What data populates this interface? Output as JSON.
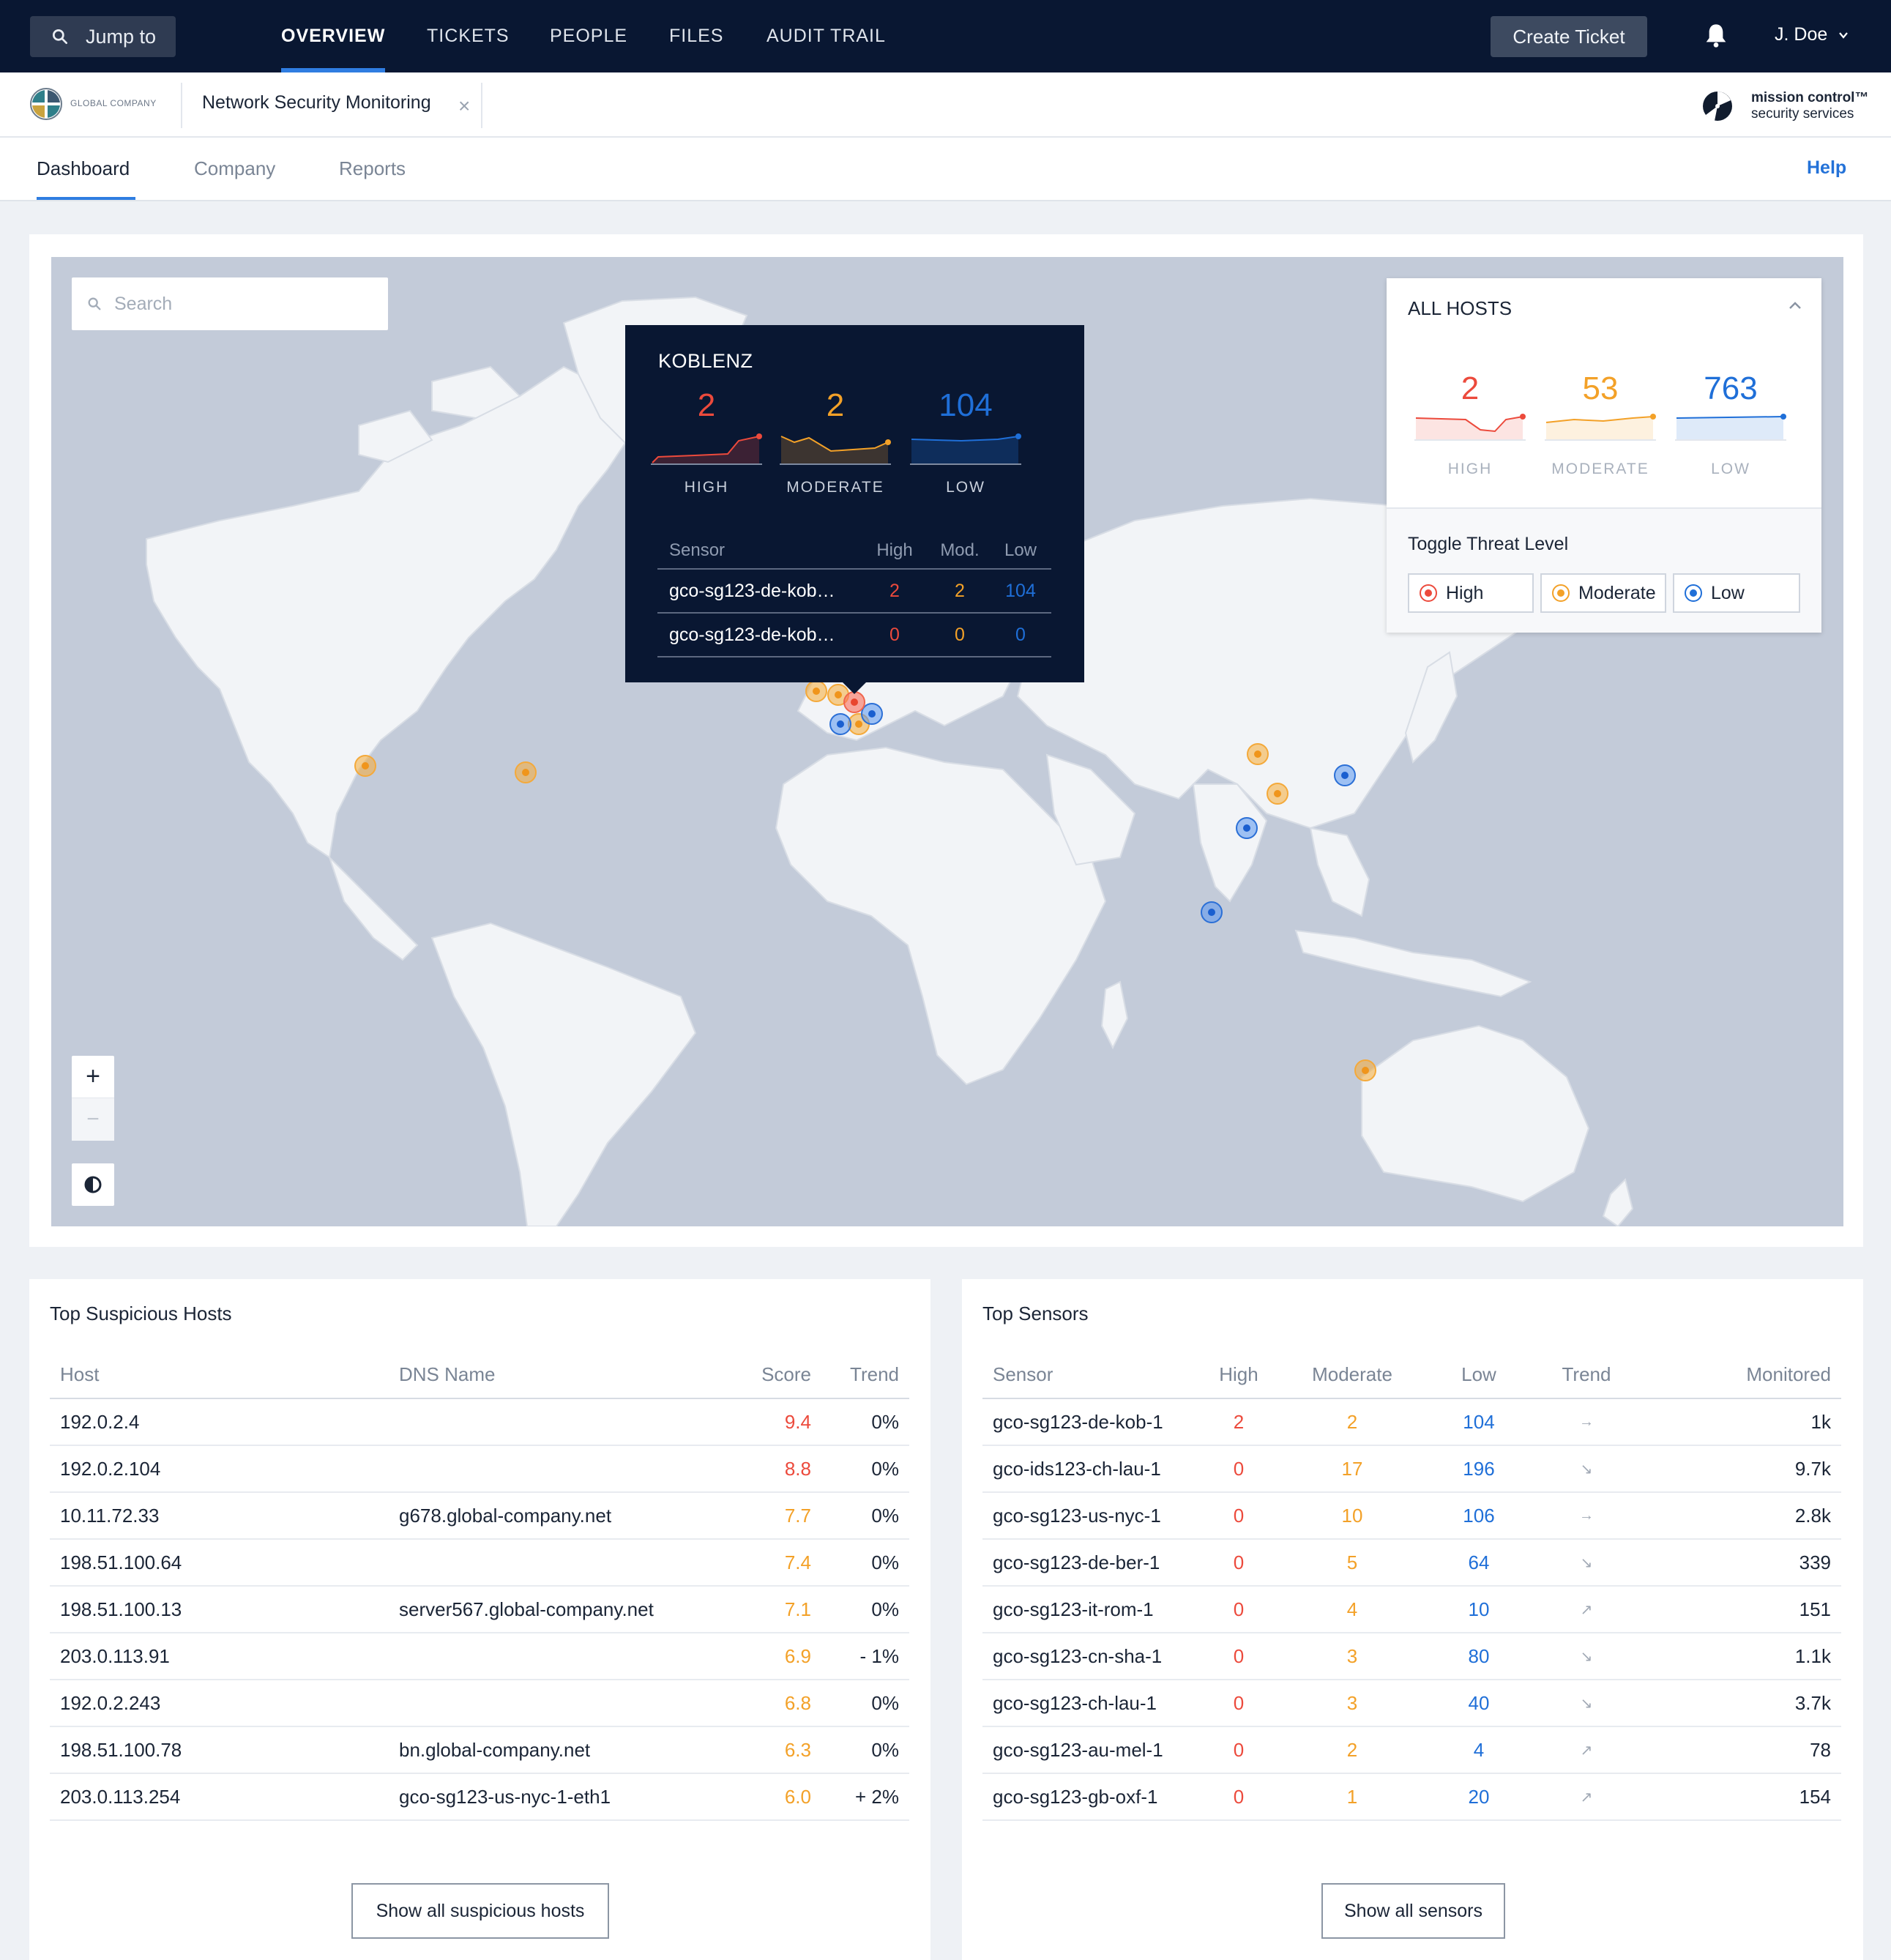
{
  "topnav": {
    "jump_label": "Jump to",
    "items": [
      "OVERVIEW",
      "TICKETS",
      "PEOPLE",
      "FILES",
      "AUDIT TRAIL"
    ],
    "create_label": "Create Ticket",
    "user_name": "J. Doe"
  },
  "header": {
    "company_logo_text": "GLOBAL COMPANY",
    "page_tab": "Network Security Monitoring",
    "vendor_line1": "mission control™",
    "vendor_line2": "security services"
  },
  "subnav": {
    "tabs": [
      "Dashboard",
      "Company",
      "Reports"
    ],
    "help": "Help"
  },
  "map": {
    "search_placeholder": "Search",
    "zoom_in": "+",
    "zoom_out": "−"
  },
  "tooltip": {
    "city": "KOBLENZ",
    "stats": [
      {
        "value": "2",
        "label": "HIGH"
      },
      {
        "value": "2",
        "label": "MODERATE"
      },
      {
        "value": "104",
        "label": "LOW"
      }
    ],
    "columns": [
      "Sensor",
      "High",
      "Mod.",
      "Low"
    ],
    "rows": [
      {
        "sensor": "gco-sg123-de-kob…",
        "high": "2",
        "mod": "2",
        "low": "104"
      },
      {
        "sensor": "gco-sg123-de-kob…",
        "high": "0",
        "mod": "0",
        "low": "0"
      }
    ]
  },
  "all_hosts": {
    "title": "ALL HOSTS",
    "stats": [
      {
        "value": "2",
        "label": "HIGH"
      },
      {
        "value": "53",
        "label": "MODERATE"
      },
      {
        "value": "763",
        "label": "LOW"
      }
    ],
    "toggle_title": "Toggle Threat Level",
    "toggles": [
      "High",
      "Moderate",
      "Low"
    ]
  },
  "colors": {
    "high": "#ec4a3c",
    "moderate": "#f3a128",
    "low": "#1f6fd8",
    "nav_bg": "#091732",
    "accent": "#2f7de1"
  },
  "suspicious_hosts": {
    "title": "Top Suspicious Hosts",
    "columns": [
      "Host",
      "DNS Name",
      "Score",
      "Trend"
    ],
    "rows": [
      {
        "host": "192.0.2.4",
        "dns": "",
        "score": "9.4",
        "trend": "0%"
      },
      {
        "host": "192.0.2.104",
        "dns": "",
        "score": "8.8",
        "trend": "0%"
      },
      {
        "host": "10.11.72.33",
        "dns": "g678.global-company.net",
        "score": "7.7",
        "trend": "0%"
      },
      {
        "host": "198.51.100.64",
        "dns": "",
        "score": "7.4",
        "trend": "0%"
      },
      {
        "host": "198.51.100.13",
        "dns": "server567.global-company.net",
        "score": "7.1",
        "trend": "0%"
      },
      {
        "host": "203.0.113.91",
        "dns": "",
        "score": "6.9",
        "trend": "- 1%"
      },
      {
        "host": "192.0.2.243",
        "dns": "",
        "score": "6.8",
        "trend": "0%"
      },
      {
        "host": "198.51.100.78",
        "dns": "bn.global-company.net",
        "score": "6.3",
        "trend": "0%"
      },
      {
        "host": "203.0.113.254",
        "dns": "gco-sg123-us-nyc-1-eth1",
        "score": "6.0",
        "trend": "+ 2%"
      }
    ],
    "button": "Show all suspicious hosts"
  },
  "sensors": {
    "title": "Top Sensors",
    "columns": [
      "Sensor",
      "High",
      "Moderate",
      "Low",
      "Trend",
      "Monitored"
    ],
    "rows": [
      {
        "sensor": "gco-sg123-de-kob-1",
        "high": "2",
        "moderate": "2",
        "low": "104",
        "trend": "→",
        "monitored": "1k"
      },
      {
        "sensor": "gco-ids123-ch-lau-1",
        "high": "0",
        "moderate": "17",
        "low": "196",
        "trend": "↘",
        "monitored": "9.7k"
      },
      {
        "sensor": "gco-sg123-us-nyc-1",
        "high": "0",
        "moderate": "10",
        "low": "106",
        "trend": "→",
        "monitored": "2.8k"
      },
      {
        "sensor": "gco-sg123-de-ber-1",
        "high": "0",
        "moderate": "5",
        "low": "64",
        "trend": "↘",
        "monitored": "339"
      },
      {
        "sensor": "gco-sg123-it-rom-1",
        "high": "0",
        "moderate": "4",
        "low": "10",
        "trend": "↗",
        "monitored": "151"
      },
      {
        "sensor": "gco-sg123-cn-sha-1",
        "high": "0",
        "moderate": "3",
        "low": "80",
        "trend": "↘",
        "monitored": "1.1k"
      },
      {
        "sensor": "gco-sg123-ch-lau-1",
        "high": "0",
        "moderate": "3",
        "low": "40",
        "trend": "↘",
        "monitored": "3.7k"
      },
      {
        "sensor": "gco-sg123-au-mel-1",
        "high": "0",
        "moderate": "2",
        "low": "4",
        "trend": "↗",
        "monitored": "78"
      },
      {
        "sensor": "gco-sg123-gb-oxf-1",
        "high": "0",
        "moderate": "1",
        "low": "20",
        "trend": "↗",
        "monitored": "154"
      }
    ],
    "button": "Show all sensors"
  }
}
